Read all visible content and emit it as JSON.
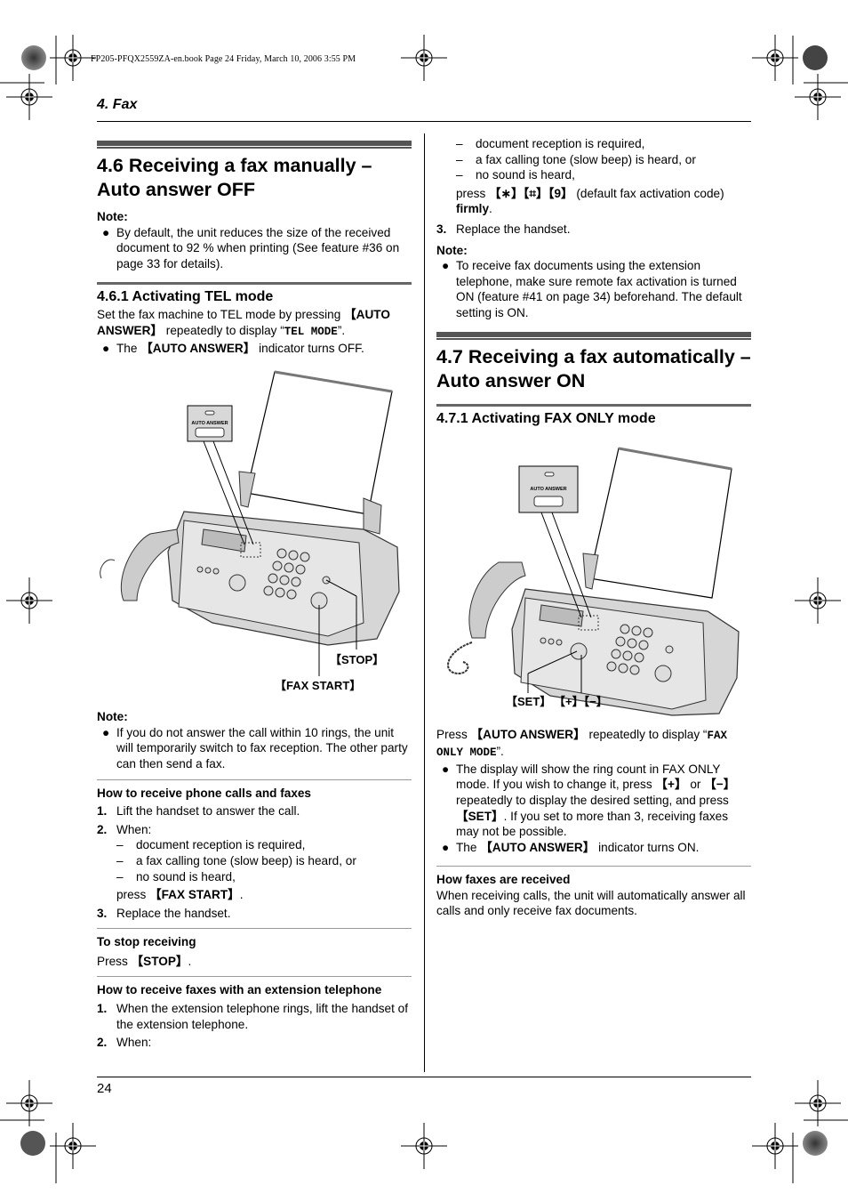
{
  "slug": "FP205-PFQX2559ZA-en.book  Page 24  Friday, March 10, 2006  3:55 PM",
  "chapter": "4. Fax",
  "page_number": "24",
  "left": {
    "section_title": "4.6 Receiving a fax manually – Auto answer OFF",
    "note_label": "Note:",
    "note_bullet": "By default, the unit reduces the size of the received document to 92 % when printing (See feature #36 on page 33 for details).",
    "sub_title": "4.6.1 Activating TEL mode",
    "tel_intro_a": "Set the fax machine to TEL mode by pressing ",
    "tel_intro_key": "【AUTO ANSWER】",
    "tel_intro_b": " repeatedly to display “",
    "tel_intro_mono": "TEL MODE",
    "tel_intro_c": "”.",
    "tel_bullet_a": "The ",
    "tel_bullet_key": "【AUTO ANSWER】",
    "tel_bullet_b": " indicator turns OFF.",
    "illustration": {
      "callout_label": "AUTO ANSWER",
      "stop_label": "【STOP】",
      "fax_start_label": "【FAX START】"
    },
    "note2_label": "Note:",
    "note2_bullet": "If you do not answer the call within 10 rings, the unit will temporarily switch to fax reception. The other party can then send a fax.",
    "phone_calls_heading": "How to receive phone calls and faxes",
    "phone_steps": {
      "s1_num": "1.",
      "s1": "Lift the handset to answer the call.",
      "s2_num": "2.",
      "s2": "When:",
      "dashes": [
        "document reception is required,",
        "a fax calling tone (slow beep) is heard, or",
        "no sound is heard,"
      ],
      "press_a": "press ",
      "press_key": "【FAX START】",
      "press_b": ".",
      "s3_num": "3.",
      "s3": "Replace the handset."
    },
    "stop_heading": "To stop receiving",
    "stop_a": "Press ",
    "stop_key": "【STOP】",
    "stop_b": ".",
    "ext_heading": "How to receive faxes with an extension telephone",
    "ext_s1_num": "1.",
    "ext_s1": "When the extension telephone rings, lift the handset of the extension telephone.",
    "ext_s2_num": "2.",
    "ext_s2": "When:"
  },
  "right": {
    "dashes": [
      "document reception is required,",
      "a fax calling tone (slow beep) is heard, or",
      "no sound is heard,"
    ],
    "press_a": "press ",
    "press_keys": "【∗】【⌗】【9】",
    "press_b": " (default fax activation code) ",
    "press_bold": "firmly",
    "press_c": ".",
    "s3_num": "3.",
    "s3": "Replace the handset.",
    "note_label": "Note:",
    "note_bullet": "To receive fax documents using the extension telephone, make sure remote fax activation is turned ON (feature #41 on page 34) beforehand. The default setting is ON.",
    "section_title": "4.7 Receiving a fax automatically – Auto answer ON",
    "sub_title": "4.7.1 Activating FAX ONLY mode",
    "illustration": {
      "callout_label": "AUTO ANSWER",
      "set_label": "【SET】",
      "plusminus_label": "【+】【−】"
    },
    "press_intro_a": "Press ",
    "press_intro_key": "【AUTO ANSWER】",
    "press_intro_b": " repeatedly to display “",
    "press_intro_mono": "FAX ONLY MODE",
    "press_intro_c": "”.",
    "bullet1_a": "The display will show the ring count in FAX ONLY mode. If you wish to change it, press ",
    "bullet1_k1": "【+】",
    "bullet1_b": " or ",
    "bullet1_k2": "【−】",
    "bullet1_c": " repeatedly to display the desired setting, and press ",
    "bullet1_k3": "【SET】",
    "bullet1_d": ". If you set to more than 3, receiving faxes may not be possible.",
    "bullet2_a": "The ",
    "bullet2_key": "【AUTO ANSWER】",
    "bullet2_b": " indicator turns ON.",
    "how_heading": "How faxes are received",
    "how_text": "When receiving calls, the unit will automatically answer all calls and only receive fax documents."
  }
}
